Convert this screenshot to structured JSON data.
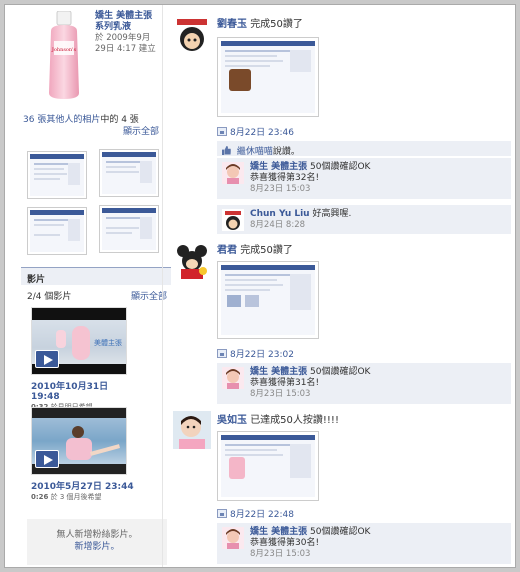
{
  "product": {
    "title": "嬌生 美體主張\n系列乳液",
    "meta": "於 2009年9月\n29日 4:17 建立",
    "brand_text": "Johnson's"
  },
  "tagged": {
    "text_count": "36 張其他人的相片",
    "text_rest": "中的 4 張",
    "show_all": "顯示全部"
  },
  "videos": {
    "header": "影片",
    "count": "2/4 個影片",
    "show_all": "顯示全部",
    "items": [
      {
        "date": "2010年10月31日 19:48",
        "duration": "0:32",
        "note": "於見明日希望",
        "brand": "美體主張"
      },
      {
        "date": "2010年5月27日 23:44",
        "duration": "0:26",
        "note": "於 3 個月後希望"
      }
    ],
    "empty_line1": "無人新增粉絲影片。",
    "empty_line2": "新增影片。"
  },
  "feed": [
    {
      "name": "劉春玉",
      "action": "完成50讚了",
      "time": "8月22日 23:46",
      "likes": {
        "name": "繼休喵喵",
        "suffix": "說讚。"
      },
      "comments": [
        {
          "name": "嬌生 美體主張",
          "text": "50個讚確認OK\n恭喜獲得第32名!",
          "time": "8月23日 15:03"
        },
        {
          "name": "Chun Yu Liu",
          "text": "好高興喔.",
          "time": "8月24日 8:28"
        }
      ]
    },
    {
      "name": "君君",
      "action": "完成50讚了",
      "time": "8月22日 23:02",
      "comments": [
        {
          "name": "嬌生 美體主張",
          "text": "50個讚確認OK\n恭喜獲得第31名!",
          "time": "8月23日 15:03"
        }
      ]
    },
    {
      "name": "吳如玉",
      "action": "已達成50人按讚!!!!",
      "time": "8月22日 22:48",
      "comments": [
        {
          "name": "嬌生 美體主張",
          "text": "50個讚確認OK\n恭喜獲得第30名!",
          "time": "8月23日 15:03"
        }
      ]
    }
  ],
  "colors": {
    "link": "#3b5998",
    "panel": "#eceff5",
    "brand_pink": "#f4b6c8"
  }
}
